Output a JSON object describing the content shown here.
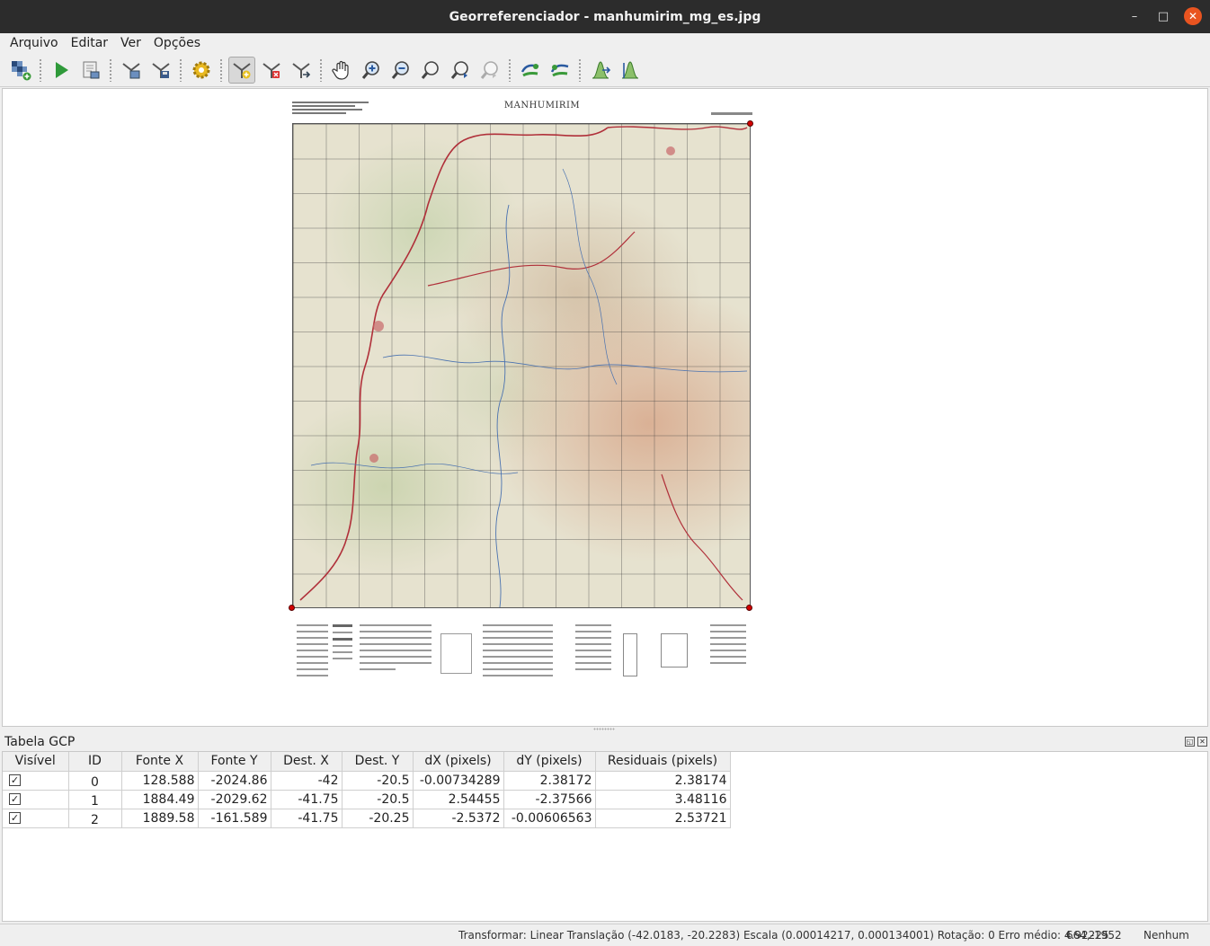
{
  "window": {
    "title": "Georreferenciador - manhumirim_mg_es.jpg",
    "controls": {
      "minimize": "–",
      "maximize": "□",
      "close": "✕"
    }
  },
  "menu": [
    "Arquivo",
    "Editar",
    "Ver",
    "Opções"
  ],
  "toolbar": {
    "icons": [
      "open-raster-icon",
      "start-georeferencing-icon",
      "generate-script-icon",
      "load-gcp-icon",
      "save-gcp-icon",
      "transformation-settings-icon",
      "add-point-icon",
      "delete-point-icon",
      "move-point-icon",
      "pan-icon",
      "zoom-in-icon",
      "zoom-out-icon",
      "zoom-to-layer-icon",
      "zoom-last-icon",
      "zoom-next-icon",
      "link-georeferencer-icon",
      "link-qgis-icon",
      "full-histogram-stretch-icon",
      "local-histogram-stretch-icon"
    ],
    "active": "add-point-icon"
  },
  "map": {
    "title": "MANHUMIRIM",
    "colors": {
      "relief": "#d6a082",
      "vegetation": "#bfcda0",
      "paper": "#e6e2cf",
      "road": "#b0303a",
      "river": "#4a72b0",
      "gcp": "#d40000"
    }
  },
  "gcp_panel": {
    "title": "Tabela GCP",
    "columns": [
      "Visível",
      "ID",
      "Fonte X",
      "Fonte Y",
      "Dest. X",
      "Dest. Y",
      "dX (pixels)",
      "dY (pixels)",
      "Residuais (pixels)"
    ],
    "rows": [
      {
        "visible": "✓",
        "id": "0",
        "src_x": "128.588",
        "src_y": "-2024.86",
        "dst_x": "-42",
        "dst_y": "-20.5",
        "dx": "-0.00734289",
        "dy": "2.38172",
        "residual": "2.38174"
      },
      {
        "visible": "✓",
        "id": "1",
        "src_x": "1884.49",
        "src_y": "-2029.62",
        "dst_x": "-41.75",
        "dst_y": "-20.5",
        "dx": "2.54455",
        "dy": "-2.37566",
        "residual": "3.48116"
      },
      {
        "visible": "✓",
        "id": "2",
        "src_x": "1889.58",
        "src_y": "-161.589",
        "dst_x": "-41.75",
        "dst_y": "-20.25",
        "dx": "-2.5372",
        "dy": "-0.00606563",
        "residual": "2.53721"
      }
    ]
  },
  "status": {
    "transform": "Transformar: Linear Translação (-42.0183, -20.2283) Escala (0.00014217, 0.000134001) Rotação: 0 Erro médio: 4.92225",
    "coords": "664,-1952",
    "crs": "Nenhum"
  }
}
